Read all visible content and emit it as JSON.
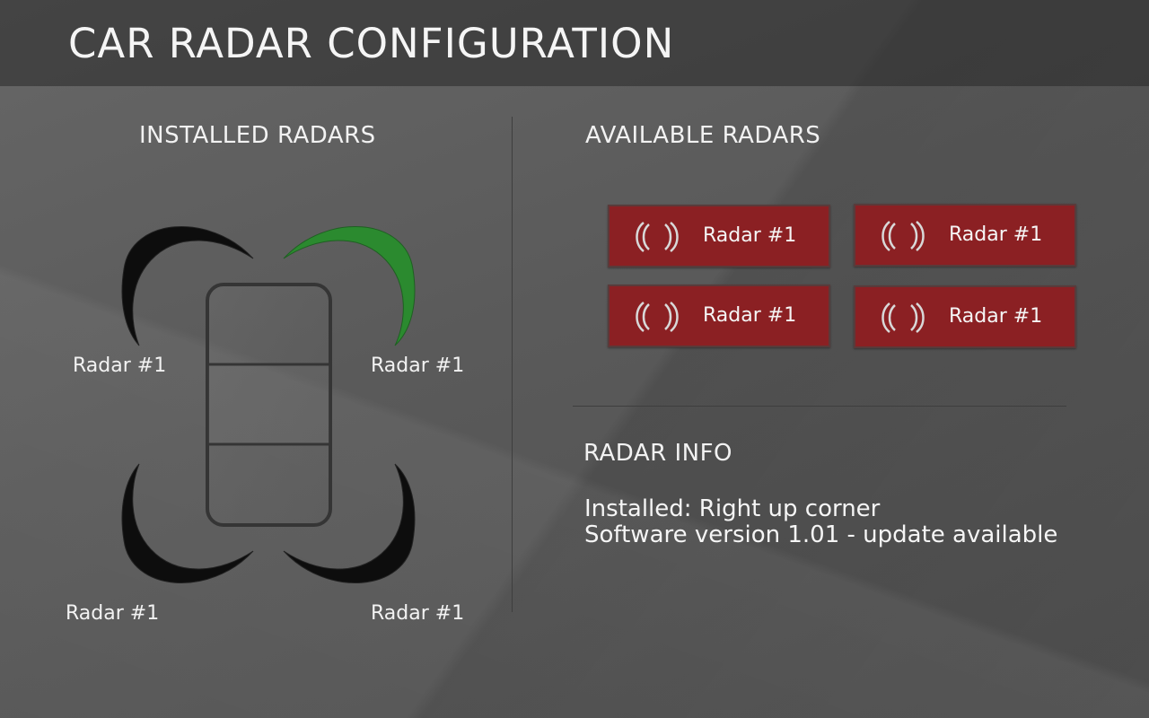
{
  "header": {
    "title": "CAR RADAR CONFIGURATION"
  },
  "installed": {
    "title": "INSTALLED RADARS",
    "radars": [
      {
        "label": "Radar #1",
        "position": "top-left",
        "active": false
      },
      {
        "label": "Radar #1",
        "position": "top-right",
        "active": true
      },
      {
        "label": "Radar #1",
        "position": "bottom-left",
        "active": false
      },
      {
        "label": "Radar #1",
        "position": "bottom-right",
        "active": false
      }
    ]
  },
  "available": {
    "title": "AVAILABLE RADARS",
    "items": [
      {
        "label": "Radar #1",
        "icon": "radar-waves-icon"
      },
      {
        "label": "Radar #1",
        "icon": "radar-waves-icon"
      },
      {
        "label": "Radar #1",
        "icon": "radar-waves-icon"
      },
      {
        "label": "Radar #1",
        "icon": "radar-waves-icon"
      }
    ]
  },
  "info": {
    "title": "RADAR INFO",
    "installed_line": "Installed: Right up corner",
    "software_line": "Software version 1.01 - update available"
  },
  "colors": {
    "active_radar": "#2b8a2f",
    "inactive_radar": "#0d0d0d",
    "button_bg": "#8b2023"
  }
}
